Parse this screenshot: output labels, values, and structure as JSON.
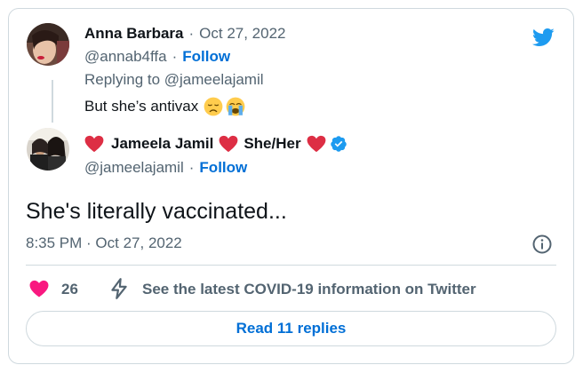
{
  "reply_tweet": {
    "display_name": "Anna Barbara",
    "date": "Oct 27, 2022",
    "handle": "@annab4ffa",
    "follow_label": "Follow",
    "replying_to": "Replying to @jameelajamil",
    "text": "But she’s antivax"
  },
  "main_tweet": {
    "display_name": "Jameela Jamil",
    "pronouns": "She/Her",
    "handle": "@jameelajamil",
    "follow_label": "Follow",
    "text": "She's literally vaccinated...",
    "timestamp": "8:35 PM · Oct 27, 2022"
  },
  "actions": {
    "like_count": "26",
    "covid_link": "See the latest COVID-19 information on Twitter",
    "read_replies": "Read 11 replies"
  },
  "separator": "·",
  "colors": {
    "brand_blue": "#1d9bf0",
    "link_blue": "#006fd6",
    "like_pink": "#f91880",
    "heart_red": "#dd2e44",
    "muted_text": "#536471",
    "border": "#cfd9de"
  },
  "icons": [
    "twitter-bird-icon",
    "heart-icon",
    "verified-badge-icon",
    "info-icon",
    "lightning-bolt-icon",
    "disappointed-face-emoji",
    "crying-face-emoji"
  ]
}
